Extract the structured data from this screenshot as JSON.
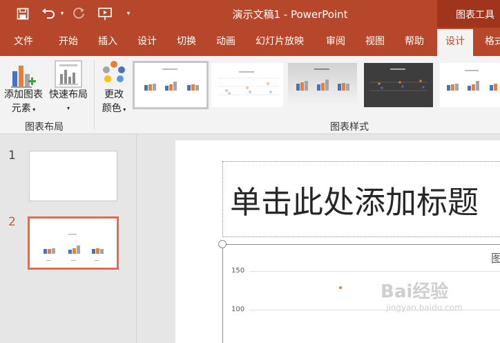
{
  "window": {
    "title": "演示文稿1 - PowerPoint",
    "context_tab": "图表工具"
  },
  "tabs": [
    {
      "label": "文件"
    },
    {
      "label": "开始"
    },
    {
      "label": "插入"
    },
    {
      "label": "设计"
    },
    {
      "label": "切换"
    },
    {
      "label": "动画"
    },
    {
      "label": "幻灯片放映"
    },
    {
      "label": "审阅"
    },
    {
      "label": "视图"
    },
    {
      "label": "帮助"
    },
    {
      "label": "设计",
      "active": true
    },
    {
      "label": "格式"
    }
  ],
  "ribbon": {
    "add_element_line1": "添加图表",
    "add_element_line2": "元素",
    "quick_layout": "快速布局",
    "layout_group_label": "图表布局",
    "change_color_line1": "更改",
    "change_color_line2": "颜色",
    "styles_group_label": "图表样式"
  },
  "slides_pane": {
    "slides": [
      {
        "number": "1"
      },
      {
        "number": "2",
        "active": true
      }
    ]
  },
  "slide": {
    "title_placeholder": "单击此处添加标题",
    "chart_title_fragment": "图",
    "y_ticks": [
      "150",
      "100"
    ]
  },
  "watermark": {
    "line1": "Bai经验",
    "line2": "jingyan.baidu.com"
  },
  "colors": {
    "title_bar": "#b7472a",
    "context_bar": "#a1341c",
    "ribbon": "#f3f3f3",
    "active_slide_border": "#d96f4f",
    "series_blue": "#4472c4",
    "series_orange": "#ed7d31",
    "series_gray": "#a5a5a5"
  }
}
